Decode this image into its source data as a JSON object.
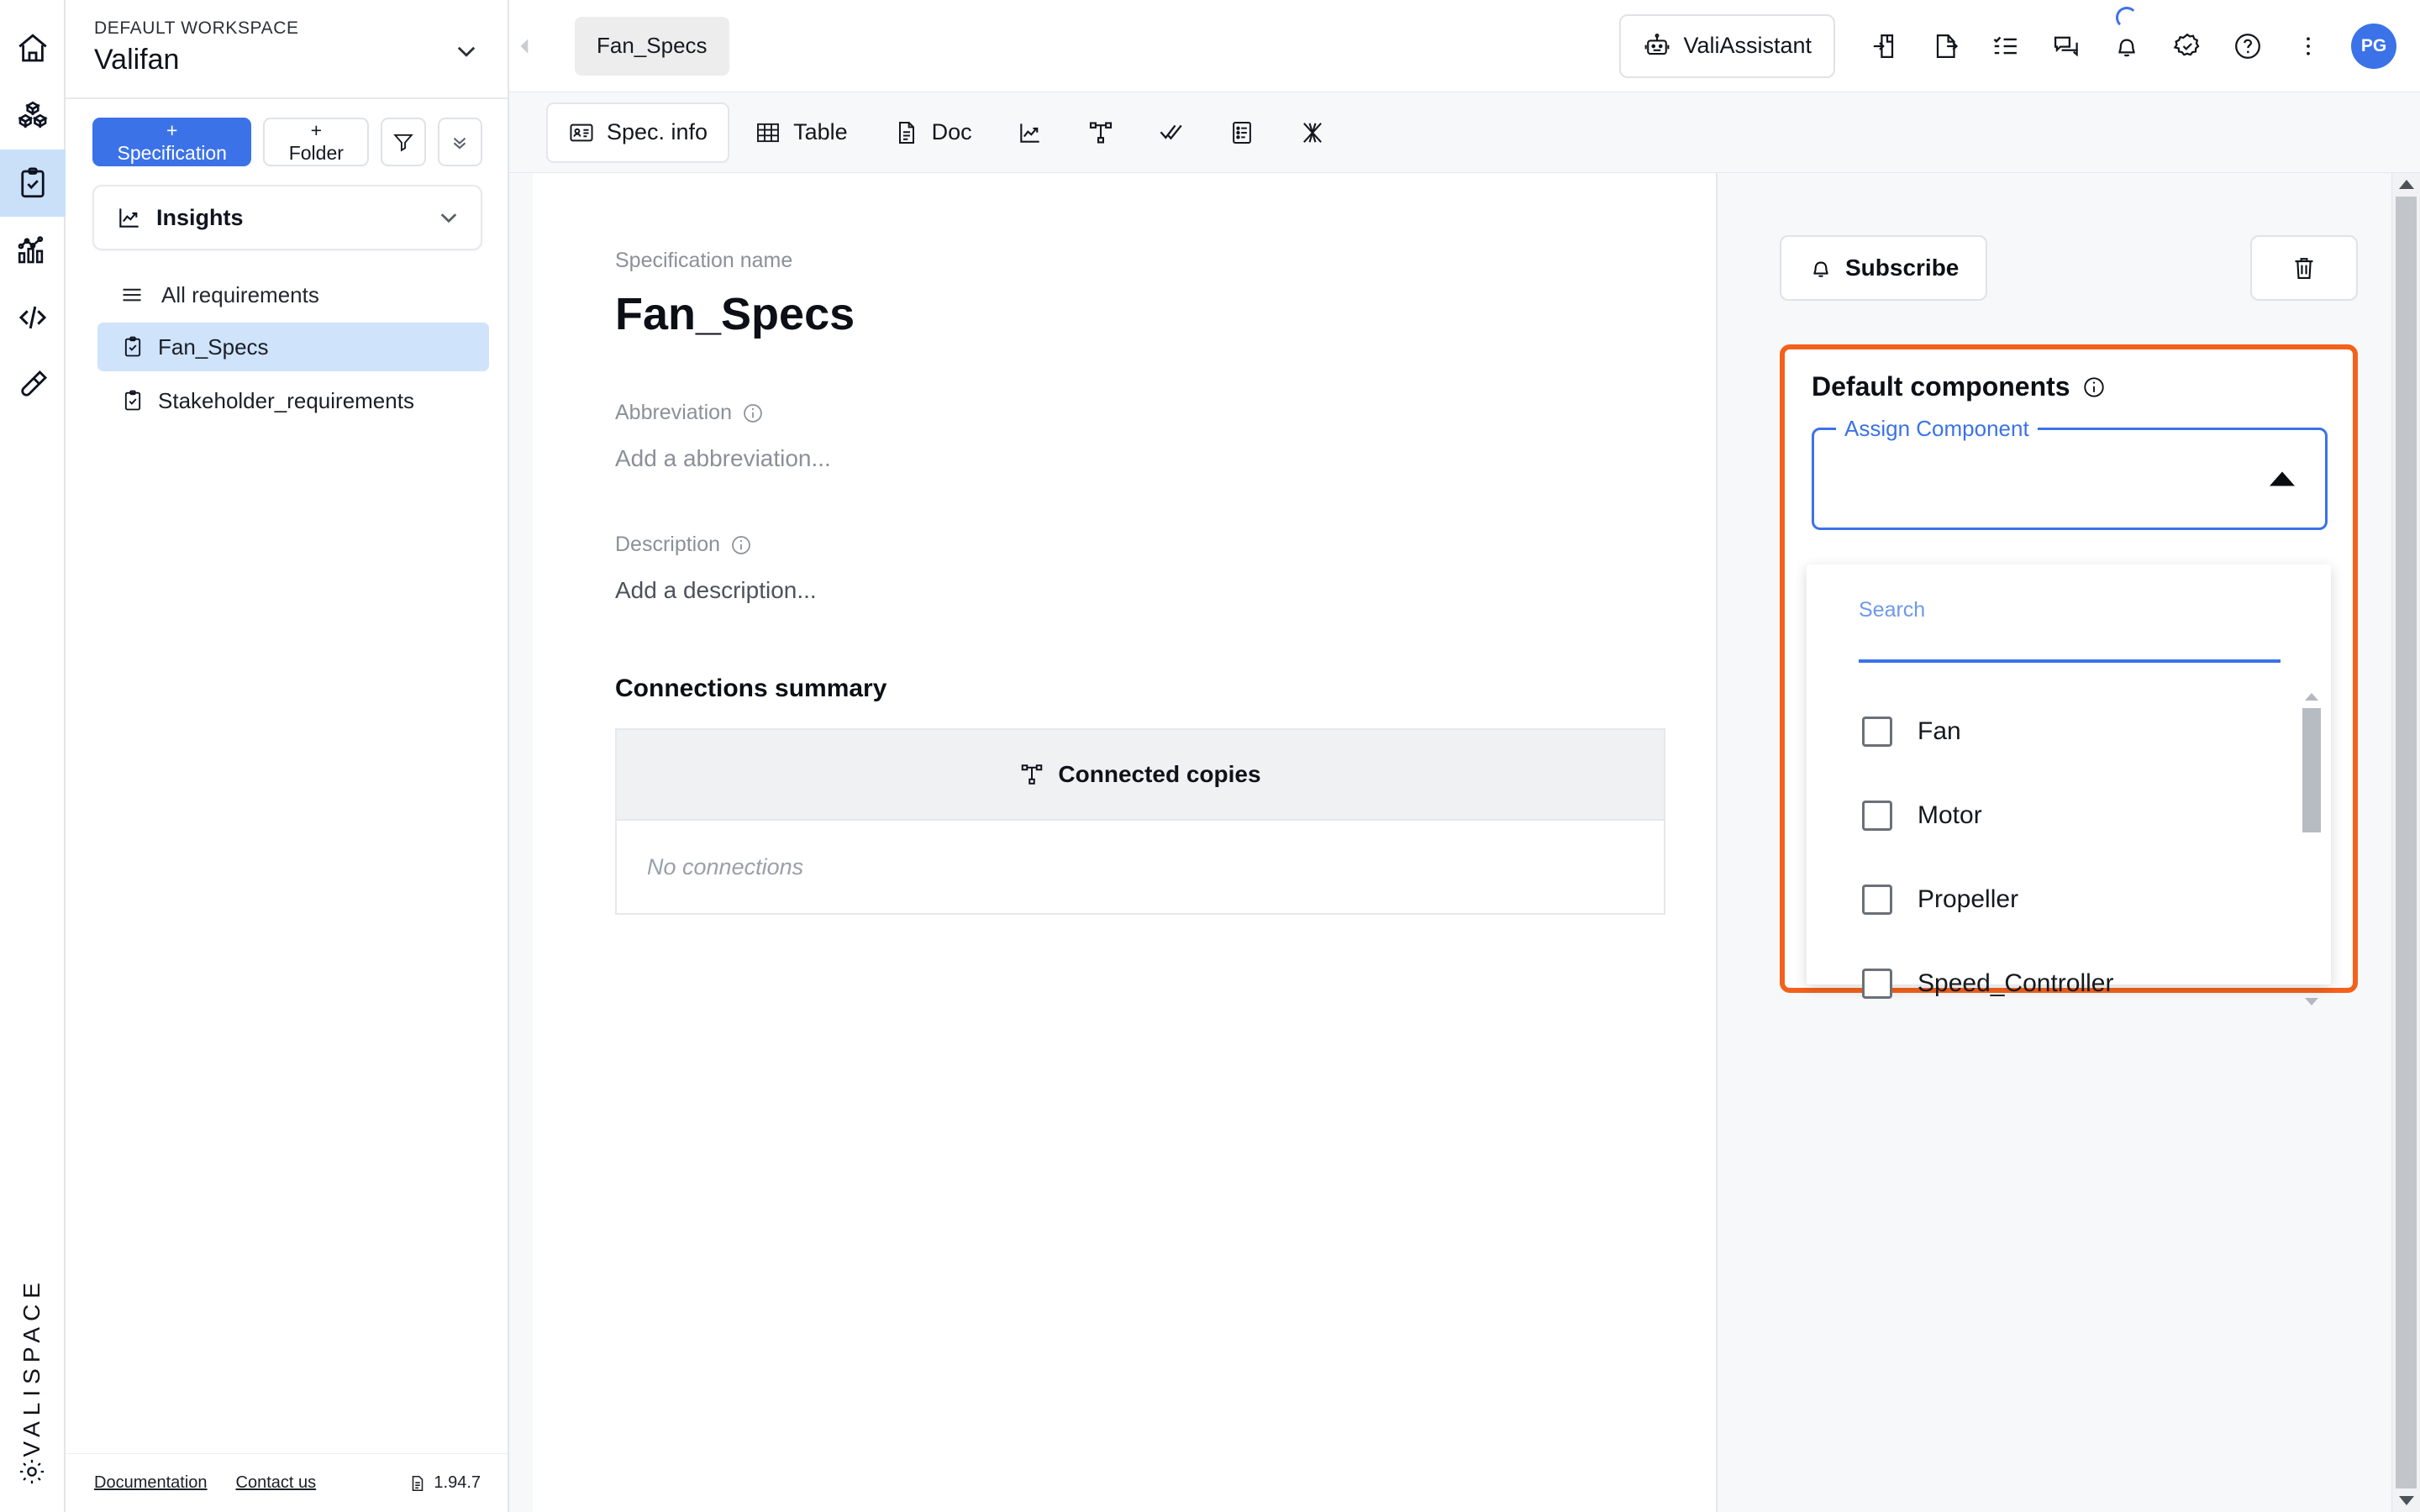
{
  "rail": {
    "items": [
      {
        "name": "home-icon",
        "label": "Home"
      },
      {
        "name": "components-icon",
        "label": "Components"
      },
      {
        "name": "requirements-icon",
        "label": "Requirements"
      },
      {
        "name": "analysis-icon",
        "label": "Analysis"
      },
      {
        "name": "code-icon",
        "label": "Code"
      },
      {
        "name": "test-icon",
        "label": "Tests"
      }
    ],
    "logo": "VALISPACE",
    "settings_icon": "gear-icon"
  },
  "sidebar": {
    "workspace_label": "DEFAULT WORKSPACE",
    "workspace_name": "Valifan",
    "new_specification_label": "+ Specification",
    "new_folder_label": "+ Folder",
    "filter_icon": "filter-icon",
    "collapse_all_icon": "double-chevron-down-icon",
    "insights_label": "Insights",
    "tree_root_label": "All requirements",
    "tree_items": [
      {
        "label": "Fan_Specs",
        "selected": true
      },
      {
        "label": "Stakeholder_requirements",
        "selected": false
      }
    ],
    "footer": {
      "documentation": "Documentation",
      "contact": "Contact us",
      "version": "1.94.7"
    }
  },
  "topbar": {
    "collapse_icon": "chevron-left-icon",
    "open_tab": "Fan_Specs",
    "assistant_label": "ValiAssistant",
    "icons": [
      {
        "name": "import-icon"
      },
      {
        "name": "export-icon"
      },
      {
        "name": "checklist-icon"
      },
      {
        "name": "comments-icon"
      },
      {
        "name": "bell-icon"
      },
      {
        "name": "verified-icon"
      },
      {
        "name": "help-icon"
      },
      {
        "name": "more-vertical-icon"
      }
    ],
    "avatar_initials": "PG"
  },
  "tabs": [
    {
      "label": "Spec. info",
      "icon": "spec-info-icon",
      "active": true
    },
    {
      "label": "Table",
      "icon": "table-icon",
      "active": false
    },
    {
      "label": "Doc",
      "icon": "doc-icon",
      "active": false
    },
    {
      "label": "",
      "icon": "chart-icon",
      "active": false
    },
    {
      "label": "",
      "icon": "tree-icon",
      "active": false
    },
    {
      "label": "",
      "icon": "double-check-icon",
      "active": false
    },
    {
      "label": "",
      "icon": "list-icon",
      "active": false
    },
    {
      "label": "",
      "icon": "criss-cross-icon",
      "active": false
    }
  ],
  "main": {
    "spec_name_label": "Specification name",
    "spec_name": "Fan_Specs",
    "abbreviation_label": "Abbreviation",
    "abbreviation_placeholder": "Add a abbreviation...",
    "description_label": "Description",
    "description_placeholder": "Add a description...",
    "connections_heading": "Connections summary",
    "connected_copies_label": "Connected copies",
    "no_connections_label": "No connections"
  },
  "right": {
    "subscribe_label": "Subscribe",
    "delete_icon": "trash-icon",
    "default_components_title": "Default components",
    "info_icon": "info-icon",
    "assign_component_legend": "Assign Component",
    "search_label": "Search",
    "search_value": "",
    "component_options": [
      {
        "label": "Fan",
        "checked": false
      },
      {
        "label": "Motor",
        "checked": false
      },
      {
        "label": "Propeller",
        "checked": false
      },
      {
        "label": "Speed_Controller",
        "checked": false
      }
    ]
  },
  "colors": {
    "accent_blue": "#3b72e8",
    "highlight_orange": "#f4611c",
    "selected_row_blue": "#cfe3fa",
    "rail_active_blue": "#c9e0f8"
  }
}
